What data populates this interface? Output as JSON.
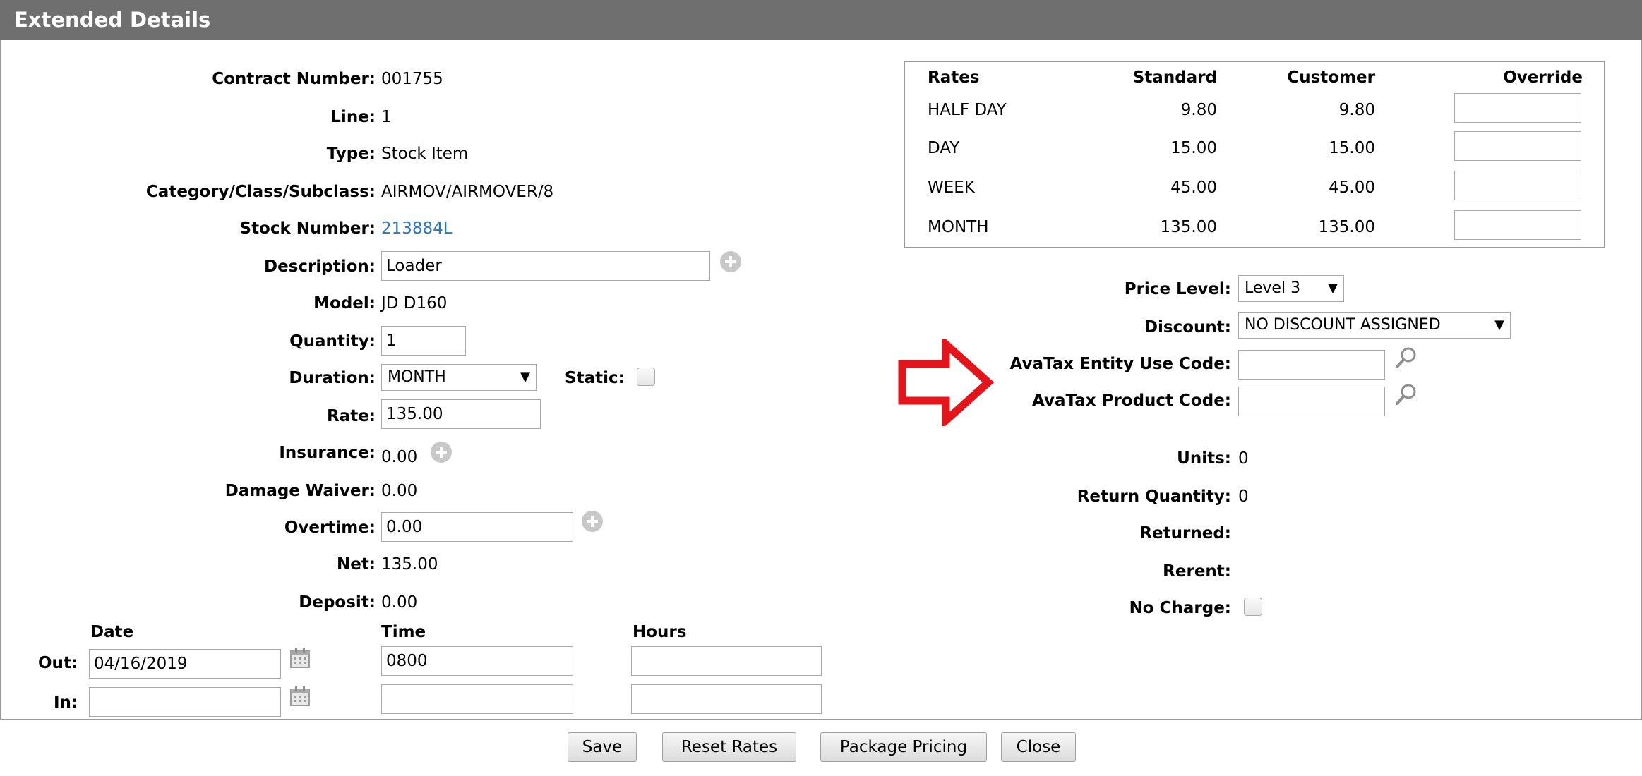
{
  "header": {
    "title": "Extended Details"
  },
  "left": {
    "contract_number": {
      "label": "Contract Number:",
      "value": "001755"
    },
    "line": {
      "label": "Line:",
      "value": "1"
    },
    "type": {
      "label": "Type:",
      "value": "Stock Item"
    },
    "category": {
      "label": "Category/Class/Subclass:",
      "value": "AIRMOV/AIRMOVER/8"
    },
    "stock_number": {
      "label": "Stock Number:",
      "value": "213884L"
    },
    "description": {
      "label": "Description:",
      "value": "Loader"
    },
    "model": {
      "label": "Model:",
      "value": "JD D160"
    },
    "quantity": {
      "label": "Quantity:",
      "value": "1"
    },
    "duration": {
      "label": "Duration:",
      "value": "MONTH"
    },
    "static": {
      "label": "Static:"
    },
    "rate": {
      "label": "Rate:",
      "value": "135.00"
    },
    "insurance": {
      "label": "Insurance:",
      "value": "0.00"
    },
    "damage_waiver": {
      "label": "Damage Waiver:",
      "value": "0.00"
    },
    "overtime": {
      "label": "Overtime:",
      "value": "0.00"
    },
    "net": {
      "label": "Net:",
      "value": "135.00"
    },
    "deposit": {
      "label": "Deposit:",
      "value": "0.00"
    }
  },
  "schedule": {
    "headers": {
      "date": "Date",
      "time": "Time",
      "hours": "Hours"
    },
    "out": {
      "label": "Out:",
      "date": "04/16/2019",
      "time": "0800",
      "hours": ""
    },
    "in": {
      "label": "In:",
      "date": "",
      "time": "",
      "hours": ""
    }
  },
  "rates_table": {
    "headers": [
      "Rates",
      "Standard",
      "Customer",
      "Override"
    ],
    "rows": [
      {
        "name": "HALF DAY",
        "standard": "9.80",
        "customer": "9.80",
        "override": ""
      },
      {
        "name": "DAY",
        "standard": "15.00",
        "customer": "15.00",
        "override": ""
      },
      {
        "name": "WEEK",
        "standard": "45.00",
        "customer": "45.00",
        "override": ""
      },
      {
        "name": "MONTH",
        "standard": "135.00",
        "customer": "135.00",
        "override": ""
      }
    ]
  },
  "right": {
    "price_level": {
      "label": "Price Level:",
      "value": "Level 3"
    },
    "discount": {
      "label": "Discount:",
      "value": "NO DISCOUNT ASSIGNED"
    },
    "avatax_entity": {
      "label": "AvaTax Entity Use Code:",
      "value": ""
    },
    "avatax_product": {
      "label": "AvaTax Product Code:",
      "value": ""
    },
    "units": {
      "label": "Units:",
      "value": "0"
    },
    "return_quantity": {
      "label": "Return Quantity:",
      "value": "0"
    },
    "returned": {
      "label": "Returned:",
      "value": ""
    },
    "rerent": {
      "label": "Rerent:",
      "value": ""
    },
    "no_charge": {
      "label": "No Charge:"
    }
  },
  "annotation": {
    "arrow_color": "#e3151a"
  },
  "buttons": {
    "save": "Save",
    "reset_rates": "Reset Rates",
    "package_pricing": "Package Pricing",
    "close": "Close"
  },
  "icons": {
    "add": "plus-circle-icon",
    "calendar": "calendar-icon",
    "lookup": "magnifier-icon",
    "dropdown": "triangle-down-icon"
  },
  "colors": {
    "header_bg": "#6f6f6f",
    "link": "#2a78c2",
    "border": "#9a9a9a"
  }
}
